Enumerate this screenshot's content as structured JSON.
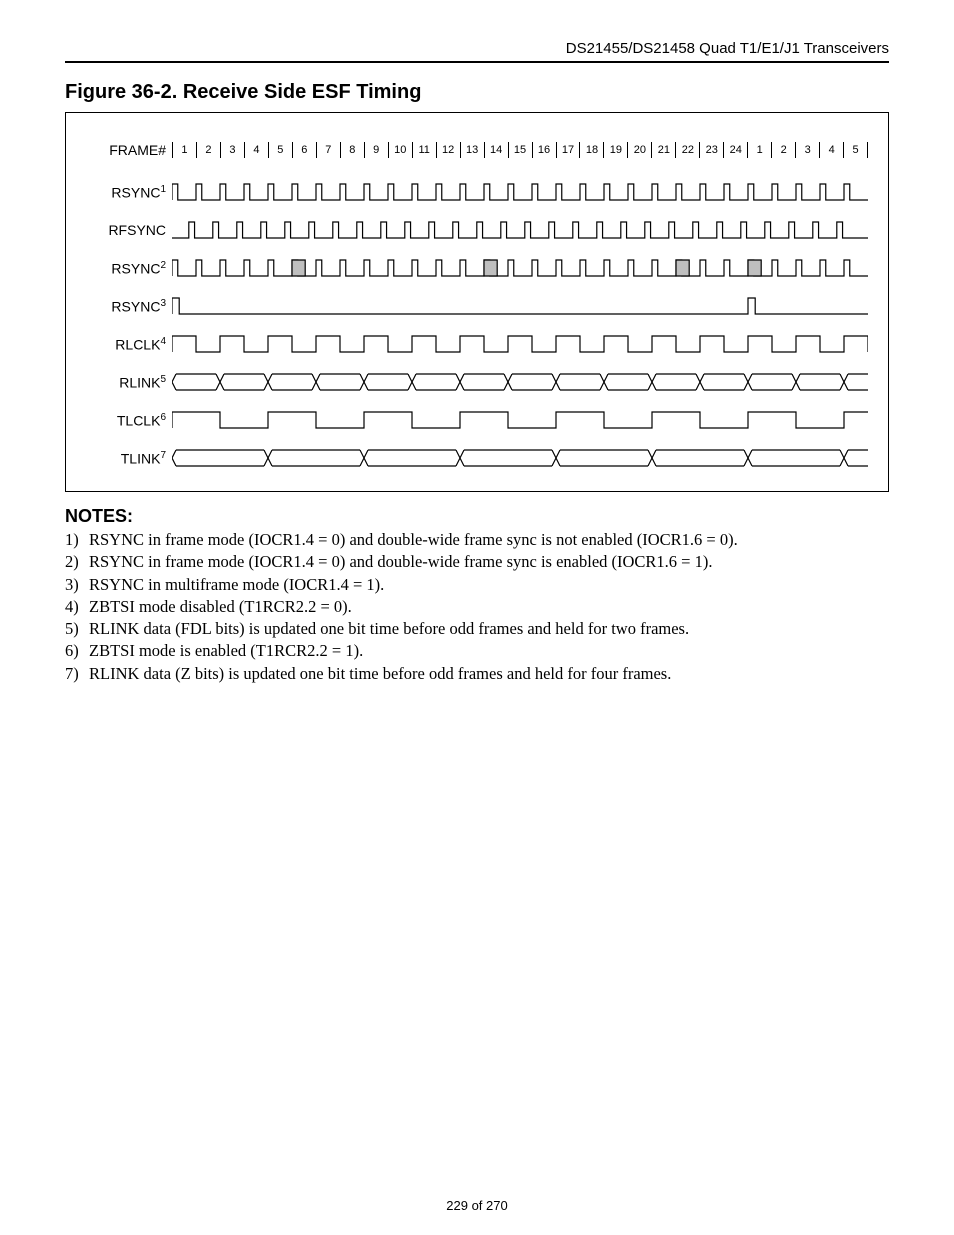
{
  "header": {
    "running": "DS21455/DS21458 Quad T1/E1/J1 Transceivers"
  },
  "figure": {
    "title": "Figure 36-2. Receive Side ESF Timing",
    "frames": [
      "1",
      "2",
      "3",
      "4",
      "5",
      "6",
      "7",
      "8",
      "9",
      "10",
      "11",
      "12",
      "13",
      "14",
      "15",
      "16",
      "17",
      "18",
      "19",
      "20",
      "21",
      "22",
      "23",
      "24",
      "1",
      "2",
      "3",
      "4",
      "5"
    ],
    "signals": {
      "frame_label": "FRAME#",
      "rsync1": "RSYNC",
      "rfsync": "RFSYNC",
      "rsync2": "RSYNC",
      "rsync3": "RSYNC",
      "rlclk": "RLCLK",
      "rlink": "RLINK",
      "tlclk": "TLCLK",
      "tlink": "TLINK"
    },
    "sups": {
      "rsync1": "1",
      "rsync2": "2",
      "rsync3": "3",
      "rlclk": "4",
      "rlink": "5",
      "tlclk": "6",
      "tlink": "7"
    }
  },
  "notes": {
    "heading": "NOTES:",
    "items": [
      "RSYNC in frame mode (IOCR1.4 = 0) and double-wide frame sync is not enabled (IOCR1.6 = 0).",
      "RSYNC in frame mode (IOCR1.4 = 0) and double-wide frame sync is enabled (IOCR1.6 = 1).",
      "RSYNC in multiframe mode (IOCR1.4 = 1).",
      "ZBTSI mode disabled (T1RCR2.2 = 0).",
      "RLINK data (FDL bits) is updated one bit time before odd frames and held for two frames.",
      "ZBTSI mode is enabled (T1RCR2.2 = 1).",
      "RLINK data (Z bits) is updated one bit time before odd frames and held for four frames."
    ]
  },
  "pagenum": "229 of 270"
}
